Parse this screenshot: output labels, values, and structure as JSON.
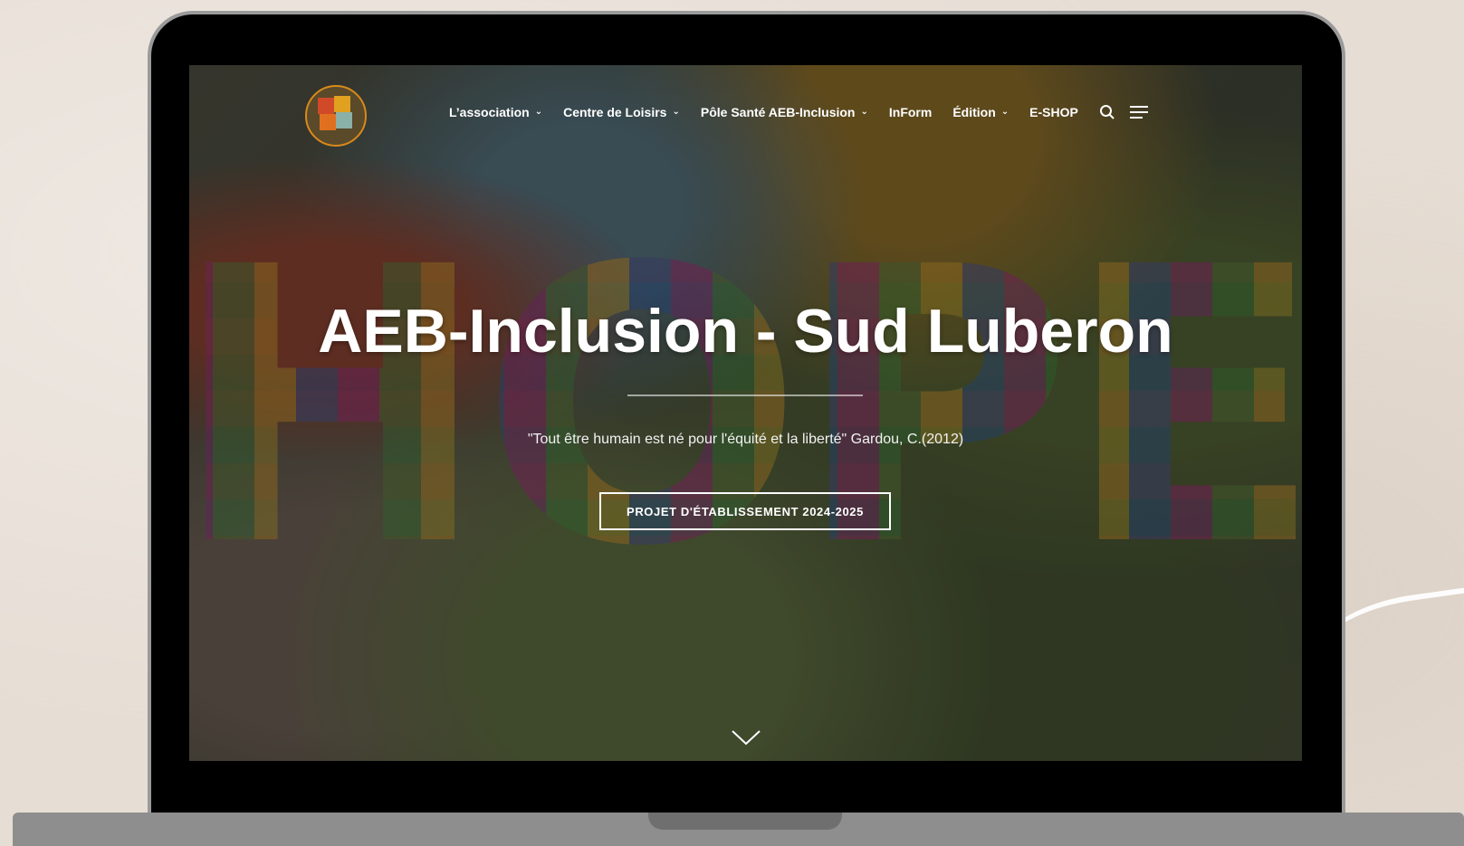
{
  "nav": {
    "items": [
      {
        "label": "L’association",
        "has_dropdown": true
      },
      {
        "label": "Centre de Loisirs",
        "has_dropdown": true
      },
      {
        "label": "Pôle Santé AEB-Inclusion",
        "has_dropdown": true
      },
      {
        "label": "InForm",
        "has_dropdown": false
      },
      {
        "label": "Édition",
        "has_dropdown": true
      },
      {
        "label": "E-SHOP",
        "has_dropdown": false
      }
    ],
    "icons": [
      "search-icon",
      "menu-icon"
    ]
  },
  "hero": {
    "background_text": "HOPE",
    "title": "AEB-Inclusion - Sud Luberon",
    "quote": "\"Tout être humain est né pour l'équité et la liberté\" Gardou, C.(2012)",
    "button_label": "PROJET D'ÉTABLISSEMENT 2024-2025"
  },
  "colors": {
    "logo_ring": "#d98a1a",
    "text": "#ffffff"
  }
}
